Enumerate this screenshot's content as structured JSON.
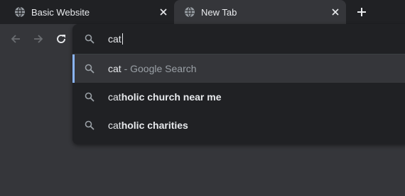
{
  "tabs": [
    {
      "title": "Basic Website",
      "icon": "globe-icon",
      "active": false
    },
    {
      "title": "New Tab",
      "icon": "globe-icon",
      "active": true
    }
  ],
  "new_tab": {
    "icon": "plus-icon"
  },
  "toolbar": {
    "back_icon": "arrow-left-icon",
    "forward_icon": "arrow-right-icon",
    "reload_icon": "reload-icon"
  },
  "omnibox": {
    "query": "cat"
  },
  "suggestions": [
    {
      "match": "cat",
      "rest": "",
      "suffix": " - Google Search",
      "selected": true
    },
    {
      "match": "cat",
      "rest": "holic church near me",
      "suffix": "",
      "selected": false
    },
    {
      "match": "cat",
      "rest": "holic charities",
      "suffix": "",
      "selected": false
    }
  ],
  "colors": {
    "tabstrip_bg": "#202124",
    "toolbar_bg": "#35363a",
    "dropdown_bg": "#202124",
    "selected_accent": "#8ab4f8",
    "text": "#e8eaed",
    "secondary_text": "#9aa0a6"
  }
}
